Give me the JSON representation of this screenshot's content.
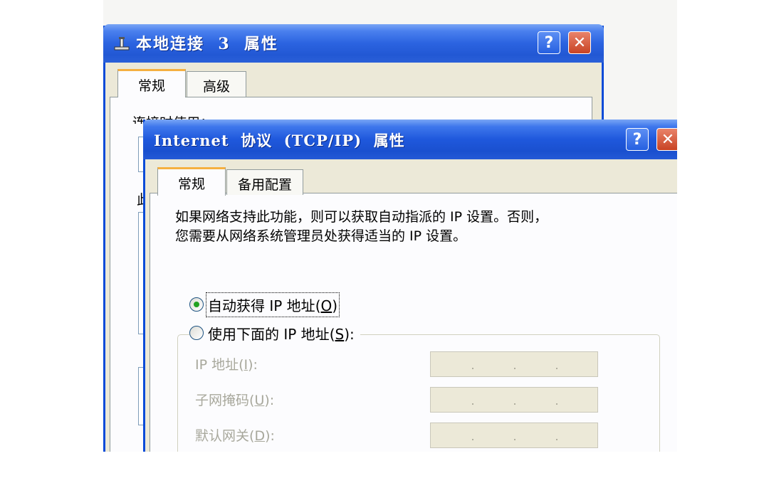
{
  "back_window": {
    "title": "本地连接  3  属性",
    "help_label": "?",
    "close_label": "✕",
    "tabs": [
      {
        "label": "常规"
      },
      {
        "label": "高级"
      }
    ],
    "connect_using_label": "连接时使用：",
    "partial_char": "此",
    "icon": "network-connection-icon"
  },
  "front_window": {
    "title": "Internet  协议  (TCP/IP)  属性",
    "help_label": "?",
    "close_label": "✕",
    "tabs": [
      {
        "label": "常规"
      },
      {
        "label": "备用配置"
      }
    ],
    "description_line1": "如果网络支持此功能，则可以获取自动指派的 IP 设置。否则，",
    "description_line2": "您需要从网络系统管理员处获得适当的 IP 设置。",
    "radio_auto": {
      "text": "自动获得 IP 地址",
      "key": "O",
      "selected": true
    },
    "radio_manual": {
      "text": "使用下面的 IP 地址",
      "key": "S",
      "selected": false
    },
    "fields": [
      {
        "label": "IP 地址",
        "key": "I",
        "value": ""
      },
      {
        "label": "子网掩码",
        "key": "U",
        "value": ""
      },
      {
        "label": "默认网关",
        "key": "D",
        "value": ""
      }
    ]
  },
  "colors": {
    "titlebar_blue": "#2258d4",
    "window_face": "#ece9d8",
    "active_tab_accent": "#f5b040",
    "close_red": "#c84324",
    "radio_dot": "#21a121"
  }
}
